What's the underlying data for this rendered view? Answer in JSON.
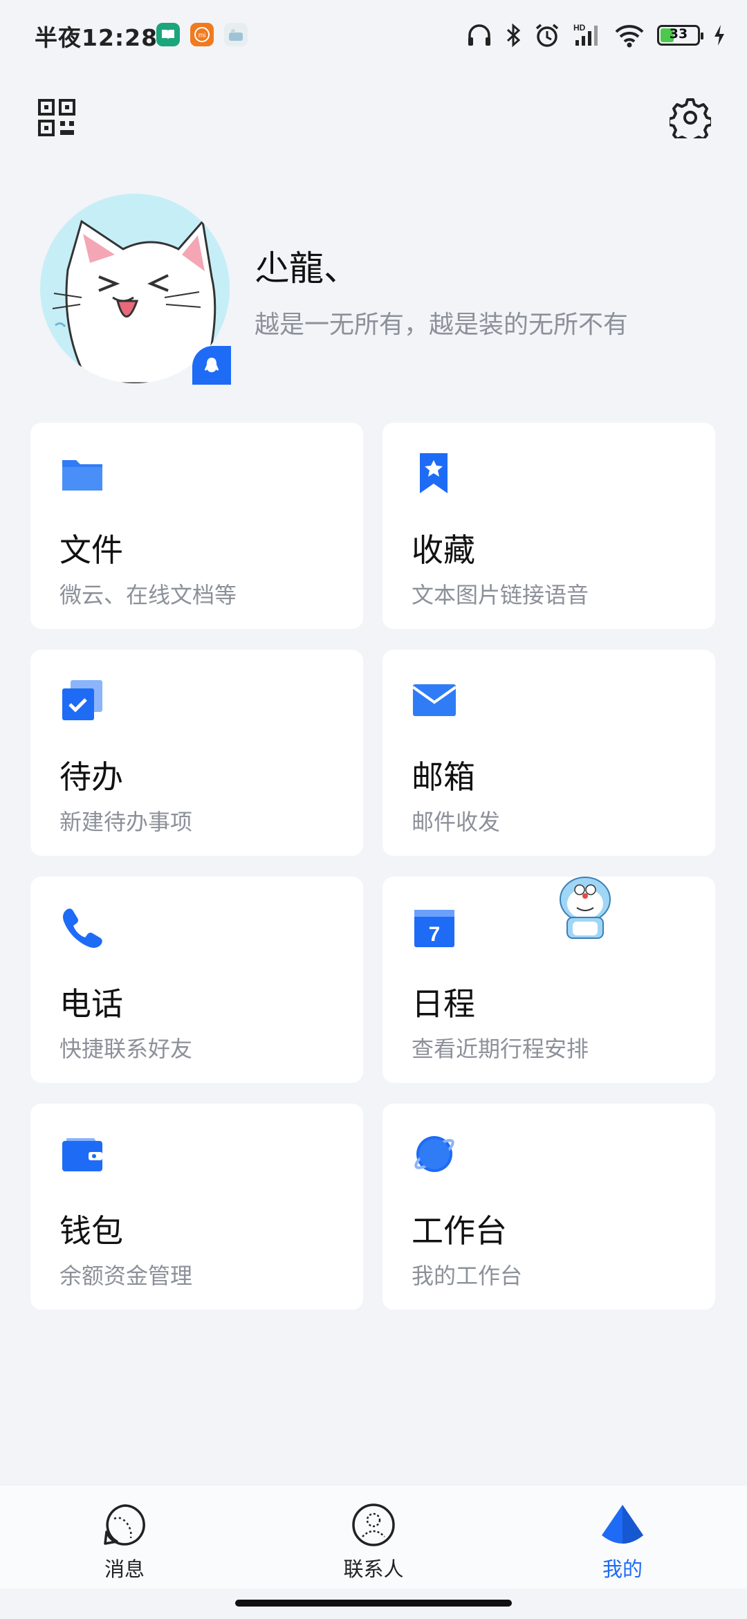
{
  "status_bar": {
    "time": "半夜12:28",
    "battery": "33"
  },
  "profile": {
    "name": "尐龍、",
    "signature": "越是一无所有，越是装的无所不有"
  },
  "cards": [
    {
      "title": "文件",
      "subtitle": "微云、在线文档等",
      "icon": "folder-icon"
    },
    {
      "title": "收藏",
      "subtitle": "文本图片链接语音",
      "icon": "bookmark-star-icon"
    },
    {
      "title": "待办",
      "subtitle": "新建待办事项",
      "icon": "todo-check-icon"
    },
    {
      "title": "邮箱",
      "subtitle": "邮件收发",
      "icon": "mail-icon"
    },
    {
      "title": "电话",
      "subtitle": "快捷联系好友",
      "icon": "phone-icon"
    },
    {
      "title": "日程",
      "subtitle": "查看近期行程安排",
      "icon": "calendar-icon",
      "icon_text": "7"
    },
    {
      "title": "钱包",
      "subtitle": "余额资金管理",
      "icon": "wallet-icon"
    },
    {
      "title": "工作台",
      "subtitle": "我的工作台",
      "icon": "planet-icon"
    }
  ],
  "bottom_nav": {
    "items": [
      {
        "label": "消息",
        "icon": "message-icon"
      },
      {
        "label": "联系人",
        "icon": "contacts-icon"
      },
      {
        "label": "我的",
        "icon": "me-icon",
        "active": true
      }
    ]
  },
  "colors": {
    "accent": "#1e6bf6",
    "background": "#f2f4f8",
    "secondary_text": "#8c9099"
  }
}
